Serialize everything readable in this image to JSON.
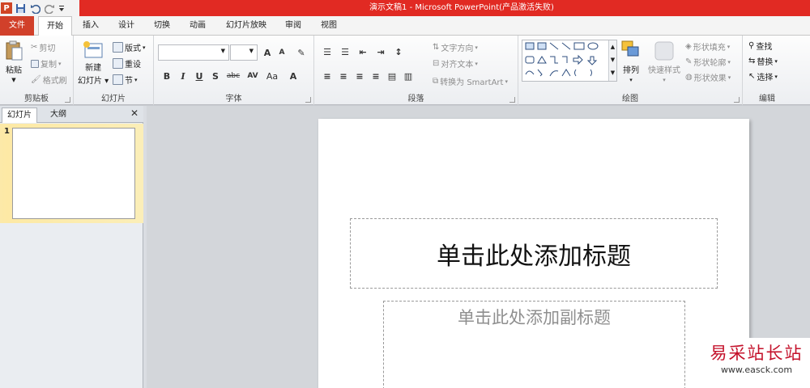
{
  "window": {
    "title": "演示文稿1 - Microsoft PowerPoint(产品激活失败)",
    "accent": "#e12a23",
    "qat_icons": [
      "powerpoint-logo-icon",
      "save-icon",
      "undo-icon",
      "redo-icon",
      "customize-qat-icon"
    ]
  },
  "tabs": [
    "文件",
    "开始",
    "插入",
    "设计",
    "切换",
    "动画",
    "幻灯片放映",
    "审阅",
    "视图"
  ],
  "ribbon": {
    "clipboard": {
      "paste": "粘贴",
      "cut": "剪切",
      "copy": "复制",
      "format_painter": "格式刷",
      "label": "剪贴板"
    },
    "slides": {
      "new_slide": "新建",
      "new_slide_sub": "幻灯片",
      "layout": "版式",
      "reset": "重设",
      "section": "节",
      "label": "幻灯片"
    },
    "font": {
      "label": "字体",
      "bold": "B",
      "italic": "I",
      "underline": "U",
      "shadow": "S",
      "strikethrough": "abc",
      "spacing": "AV",
      "case": "Aa",
      "grow": "A",
      "shrink": "A",
      "color": "A"
    },
    "paragraph": {
      "text_direction": "文字方向",
      "align_text": "对齐文本",
      "smartart": "转换为 SmartArt",
      "label": "段落"
    },
    "drawing": {
      "arrange": "排列",
      "quick_styles": "快速样式",
      "shape_fill": "形状填充",
      "shape_outline": "形状轮廓",
      "shape_effects": "形状效果",
      "label": "绘图"
    },
    "editing": {
      "find": "查找",
      "replace": "替换",
      "select": "选择",
      "label": "编辑"
    }
  },
  "panel": {
    "tab_slides": "幻灯片",
    "tab_outline": "大纲",
    "close": "✕",
    "slide_number": "1"
  },
  "slide": {
    "title_placeholder": "单击此处添加标题",
    "subtitle_placeholder": "单击此处添加副标题"
  },
  "watermark": {
    "line1": "易采站长站",
    "line2": "www.easck.com"
  }
}
